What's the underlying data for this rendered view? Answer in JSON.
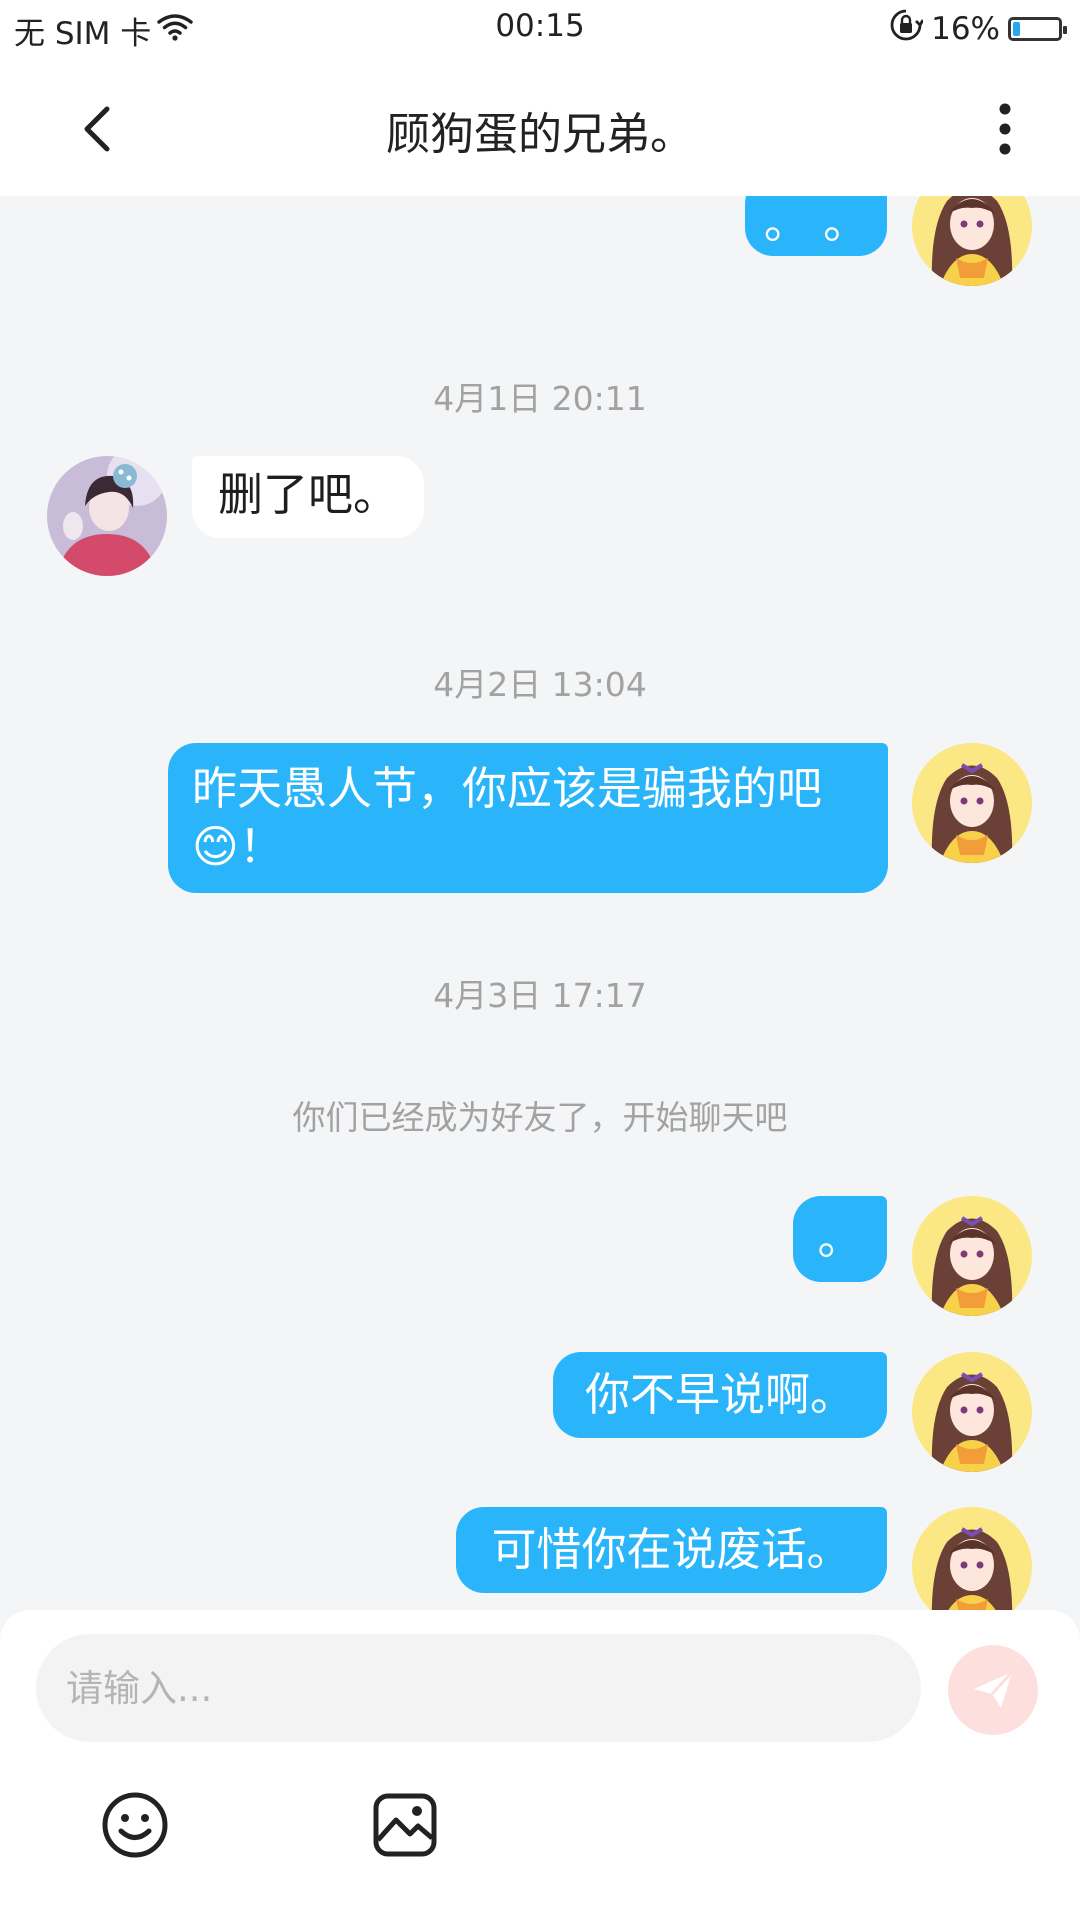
{
  "status_bar": {
    "carrier": "无 SIM 卡",
    "time": "00:15",
    "battery_percent_label": "16%",
    "battery_level": 0.16
  },
  "header": {
    "title": "顾狗蛋的兄弟。"
  },
  "messages": [
    {
      "type": "outgoing",
      "text": "。 。"
    },
    {
      "type": "timestamp",
      "text": "4月1日 20:11"
    },
    {
      "type": "incoming",
      "text": "删了吧。"
    },
    {
      "type": "timestamp",
      "text": "4月2日 13:04"
    },
    {
      "type": "outgoing",
      "text_line1": "昨天愚人节，你应该是骗我的吧",
      "emoji": "😊",
      "text_line2_tail": "！"
    },
    {
      "type": "timestamp",
      "text": "4月3日 17:17"
    },
    {
      "type": "system",
      "text": "你们已经成为好友了，开始聊天吧"
    },
    {
      "type": "outgoing",
      "text": "。"
    },
    {
      "type": "outgoing",
      "text": "你不早说啊。"
    },
    {
      "type": "outgoing",
      "text": "可惜你在说废话。"
    }
  ],
  "input": {
    "placeholder": "请输入..."
  },
  "icons": {
    "back": "chevron-left-icon",
    "more": "more-vertical-icon",
    "send": "paper-plane-icon",
    "emoji": "smiley-face-icon",
    "image": "image-icon",
    "wifi": "wifi-icon",
    "rotation_lock": "rotation-lock-icon",
    "battery": "battery-icon"
  },
  "colors": {
    "outgoing_bubble": "#2ab5fb",
    "incoming_bubble": "#ffffff",
    "chat_background": "#f4f5f7",
    "send_button_disabled": "#fde0dd",
    "timestamp_text": "#a2a2a2"
  }
}
